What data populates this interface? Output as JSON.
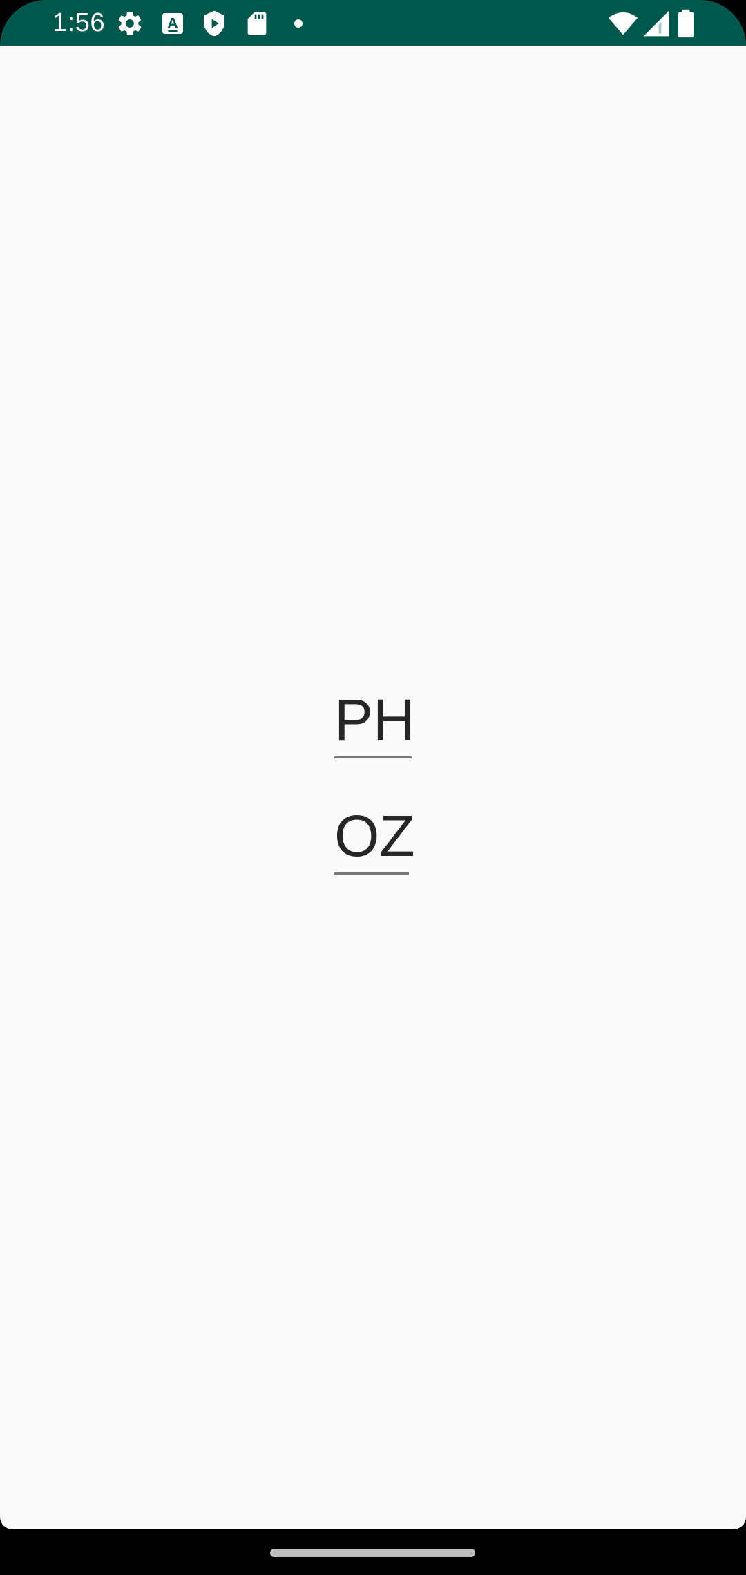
{
  "status_bar": {
    "time": "1:56",
    "background_color": "#00574b",
    "left_icons": [
      "gear-icon",
      "text-a-icon",
      "play-shield-icon",
      "sd-card-icon",
      "notification-dot-icon"
    ],
    "right_icons": [
      "wifi-icon",
      "cell-signal-icon",
      "battery-icon"
    ]
  },
  "main": {
    "background_color": "#fafafa",
    "fields": [
      {
        "value": "PH"
      },
      {
        "value": "OZ"
      }
    ]
  },
  "nav_bar": {
    "background_color": "#000000",
    "home_indicator": "home-pill"
  }
}
